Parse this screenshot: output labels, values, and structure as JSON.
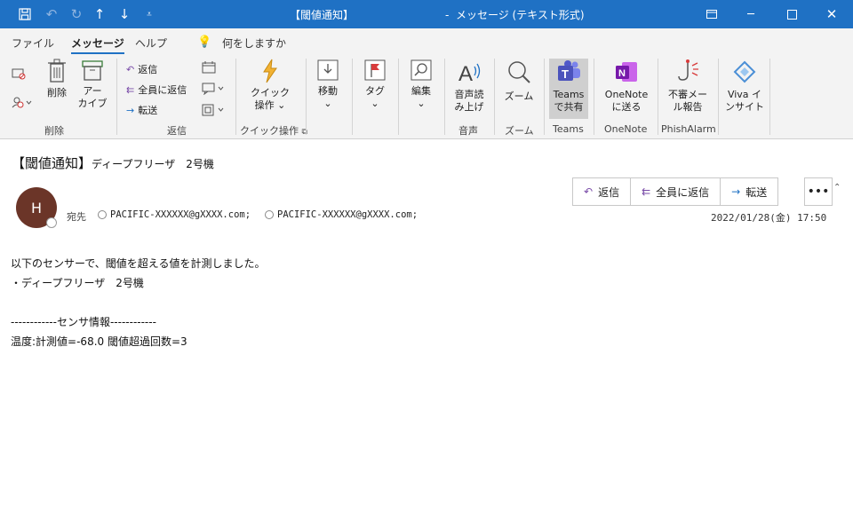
{
  "window": {
    "title": "【閾値通知】",
    "title_suffix": "-  メッセージ (テキスト形式)"
  },
  "menu": [
    "ファイル",
    "メッセージ",
    "ヘルプ"
  ],
  "search_placeholder": "何をしますか",
  "ribbon": {
    "delete_group": {
      "label": "削除",
      "delete": "削除",
      "archive_line1": "アー",
      "archive_line2": "カイブ"
    },
    "respond_group": {
      "label": "返信",
      "reply": "返信",
      "reply_all": "全員に返信",
      "forward": "転送"
    },
    "quick_group": {
      "label": "クイック操作",
      "btn_line1": "クイック",
      "btn_line2": "操作"
    },
    "move": "移動",
    "tags": "タグ",
    "editing": "編集",
    "speech_group": {
      "label": "音声",
      "btn_line1": "音声読",
      "btn_line2": "み上げ"
    },
    "zoom_group": {
      "label": "ズーム",
      "btn": "ズーム"
    },
    "teams_group": {
      "label": "Teams",
      "btn_line1": "Teams",
      "btn_line2": "で共有"
    },
    "onenote_group": {
      "label": "OneNote",
      "btn_line1": "OneNote",
      "btn_line2": "に送る"
    },
    "phish_group": {
      "label": "PhishAlarm",
      "btn_line1": "不審メー",
      "btn_line2": "ル報告"
    },
    "viva_group": {
      "btn_line1": "Viva イ",
      "btn_line2": "ンサイト"
    }
  },
  "message": {
    "subject_main": "【閾値通知】",
    "subject_rest": "ディープフリーザ　2号機",
    "avatar_initial": "H",
    "to_label": "宛先",
    "recipients": [
      "PACIFIC-XXXXXX@gXXXX.com;",
      "PACIFIC-XXXXXX@gXXXX.com;"
    ],
    "actions": {
      "reply": "返信",
      "reply_all": "全員に返信",
      "forward": "転送"
    },
    "date": "2022/01/28(金) 17:50",
    "body": [
      "以下のセンサーで、閾値を超える値を計測しました。",
      "・ディープフリーザ　2号機",
      "",
      "------------センサ情報------------",
      "温度:計測値=-68.0 閾値超過回数=3"
    ]
  },
  "colors": {
    "titlebar": "#1f71c4",
    "ribbon": "#f3f3f3",
    "accent": "#1f71c4"
  }
}
